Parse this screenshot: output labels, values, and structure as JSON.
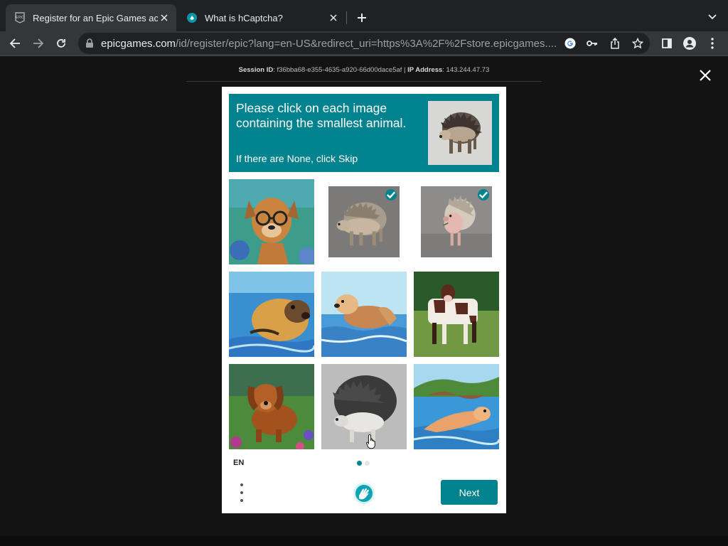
{
  "browser": {
    "tabs": [
      {
        "title": "Register for an Epic Games account",
        "active": true,
        "favicon": "epic-games-icon"
      },
      {
        "title": "What is hCaptcha?",
        "active": false,
        "favicon": "hcaptcha-icon"
      }
    ],
    "url_host": "epicgames.com",
    "url_path": "/id/register/epic?lang=en-US&redirect_uri=https%3A%2F%2Fstore.epicgames...."
  },
  "session": {
    "session_label": "Session ID",
    "session_id": ": f36bba68-e355-4635-a920-66d00dace5af",
    "separator": " | ",
    "ip_label": "IP Address",
    "ip_value": ": 143.244.47.73"
  },
  "captcha": {
    "prompt": "Please click on each image containing the smallest animal.",
    "hint": "If there are None, click Skip",
    "sample_image": "hedgehog",
    "grid": [
      {
        "subject": "dog-with-glasses",
        "selected": false
      },
      {
        "subject": "hedgehog-gray",
        "selected": true
      },
      {
        "subject": "hedgehog-standing",
        "selected": true
      },
      {
        "subject": "seal-swimming",
        "selected": false
      },
      {
        "subject": "seal-on-water",
        "selected": false
      },
      {
        "subject": "cow-in-field",
        "selected": false
      },
      {
        "subject": "dog-in-flowers",
        "selected": false
      },
      {
        "subject": "hedgehog-spiky",
        "selected": false
      },
      {
        "subject": "seal-near-rocks",
        "selected": false
      }
    ],
    "language": "EN",
    "page_dots": [
      {
        "active": true
      },
      {
        "active": false
      }
    ],
    "next_label": "Next"
  },
  "colors": {
    "accent": "#00838f",
    "browser_bg": "#202124",
    "toolbar_bg": "#35363a",
    "page_bg": "#131313"
  }
}
